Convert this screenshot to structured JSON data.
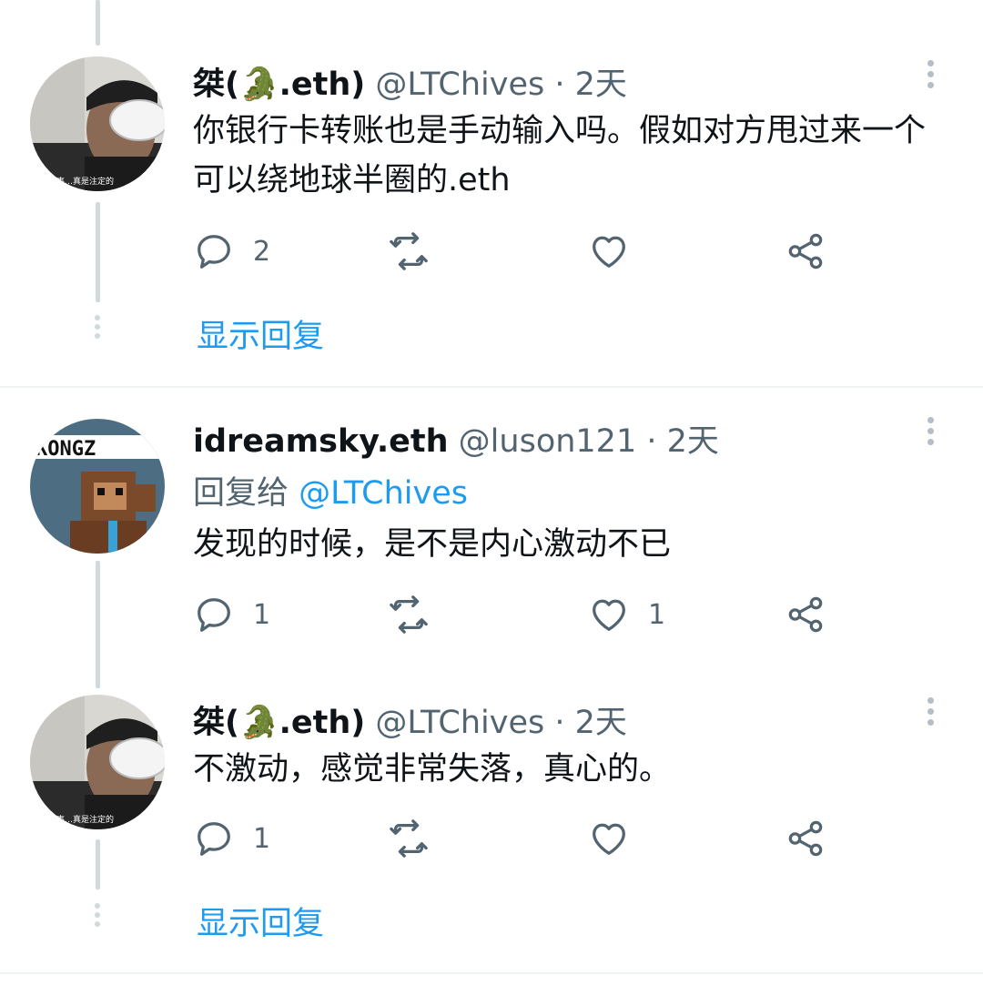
{
  "tweets": [
    {
      "name": "桀(🐊.eth)",
      "handle": "@LTChives",
      "time": "· 2天",
      "text": "你银行卡转账也是手动输入吗。假如对方甩过来一个可以绕地球半圈的.eth",
      "reply_count": "2",
      "retweet_count": "",
      "like_count": "",
      "avatar_caption": "多事…真是注定的"
    },
    {
      "name": "idreamsky.eth",
      "handle": "@luson121",
      "time": "· 2天",
      "reply_label": "回复给",
      "reply_to": "@LTChives",
      "text": "发现的时候，是不是内心激动不已",
      "reply_count": "1",
      "retweet_count": "",
      "like_count": "1",
      "avatar_caption": "KONGZ"
    },
    {
      "name": "桀(🐊.eth)",
      "handle": "@LTChives",
      "time": "· 2天",
      "text": "不激动，感觉非常失落，真心的。",
      "reply_count": "1",
      "retweet_count": "",
      "like_count": "",
      "avatar_caption": "多事…真是注定的"
    }
  ],
  "show_replies_label": "显示回复",
  "colors": {
    "accent": "#1d9bf0",
    "secondary_text": "#536471",
    "thread_line": "#cfd9de",
    "icon": "#536471"
  }
}
